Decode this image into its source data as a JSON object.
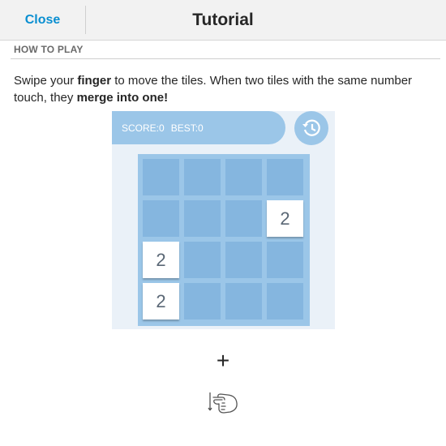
{
  "titlebar": {
    "close_label": "Close",
    "title": "Tutorial"
  },
  "section": {
    "header": "HOW TO PLAY"
  },
  "instructions": {
    "part1": "Swipe your ",
    "bold1": "finger",
    "part2": " to move the tiles. When two tiles with the same number touch, they ",
    "bold2": "merge into one!"
  },
  "demo": {
    "score_label": "SCORE:0",
    "best_label": "BEST:0",
    "history_icon": "history-clock-icon",
    "board": {
      "rows": 4,
      "cols": 4,
      "tiles": [
        {
          "row": 1,
          "col": 3,
          "value": "2"
        },
        {
          "row": 2,
          "col": 0,
          "value": "2"
        },
        {
          "row": 3,
          "col": 0,
          "value": "2"
        }
      ]
    }
  },
  "gesture": {
    "plus_icon": "plus-icon",
    "hand_icon": "swipe-hand-icon"
  },
  "colors": {
    "accent": "#0a8fd1",
    "board_bg": "#9bc6e8",
    "cell_bg": "#85b6df",
    "tile_text": "#5a6775"
  }
}
